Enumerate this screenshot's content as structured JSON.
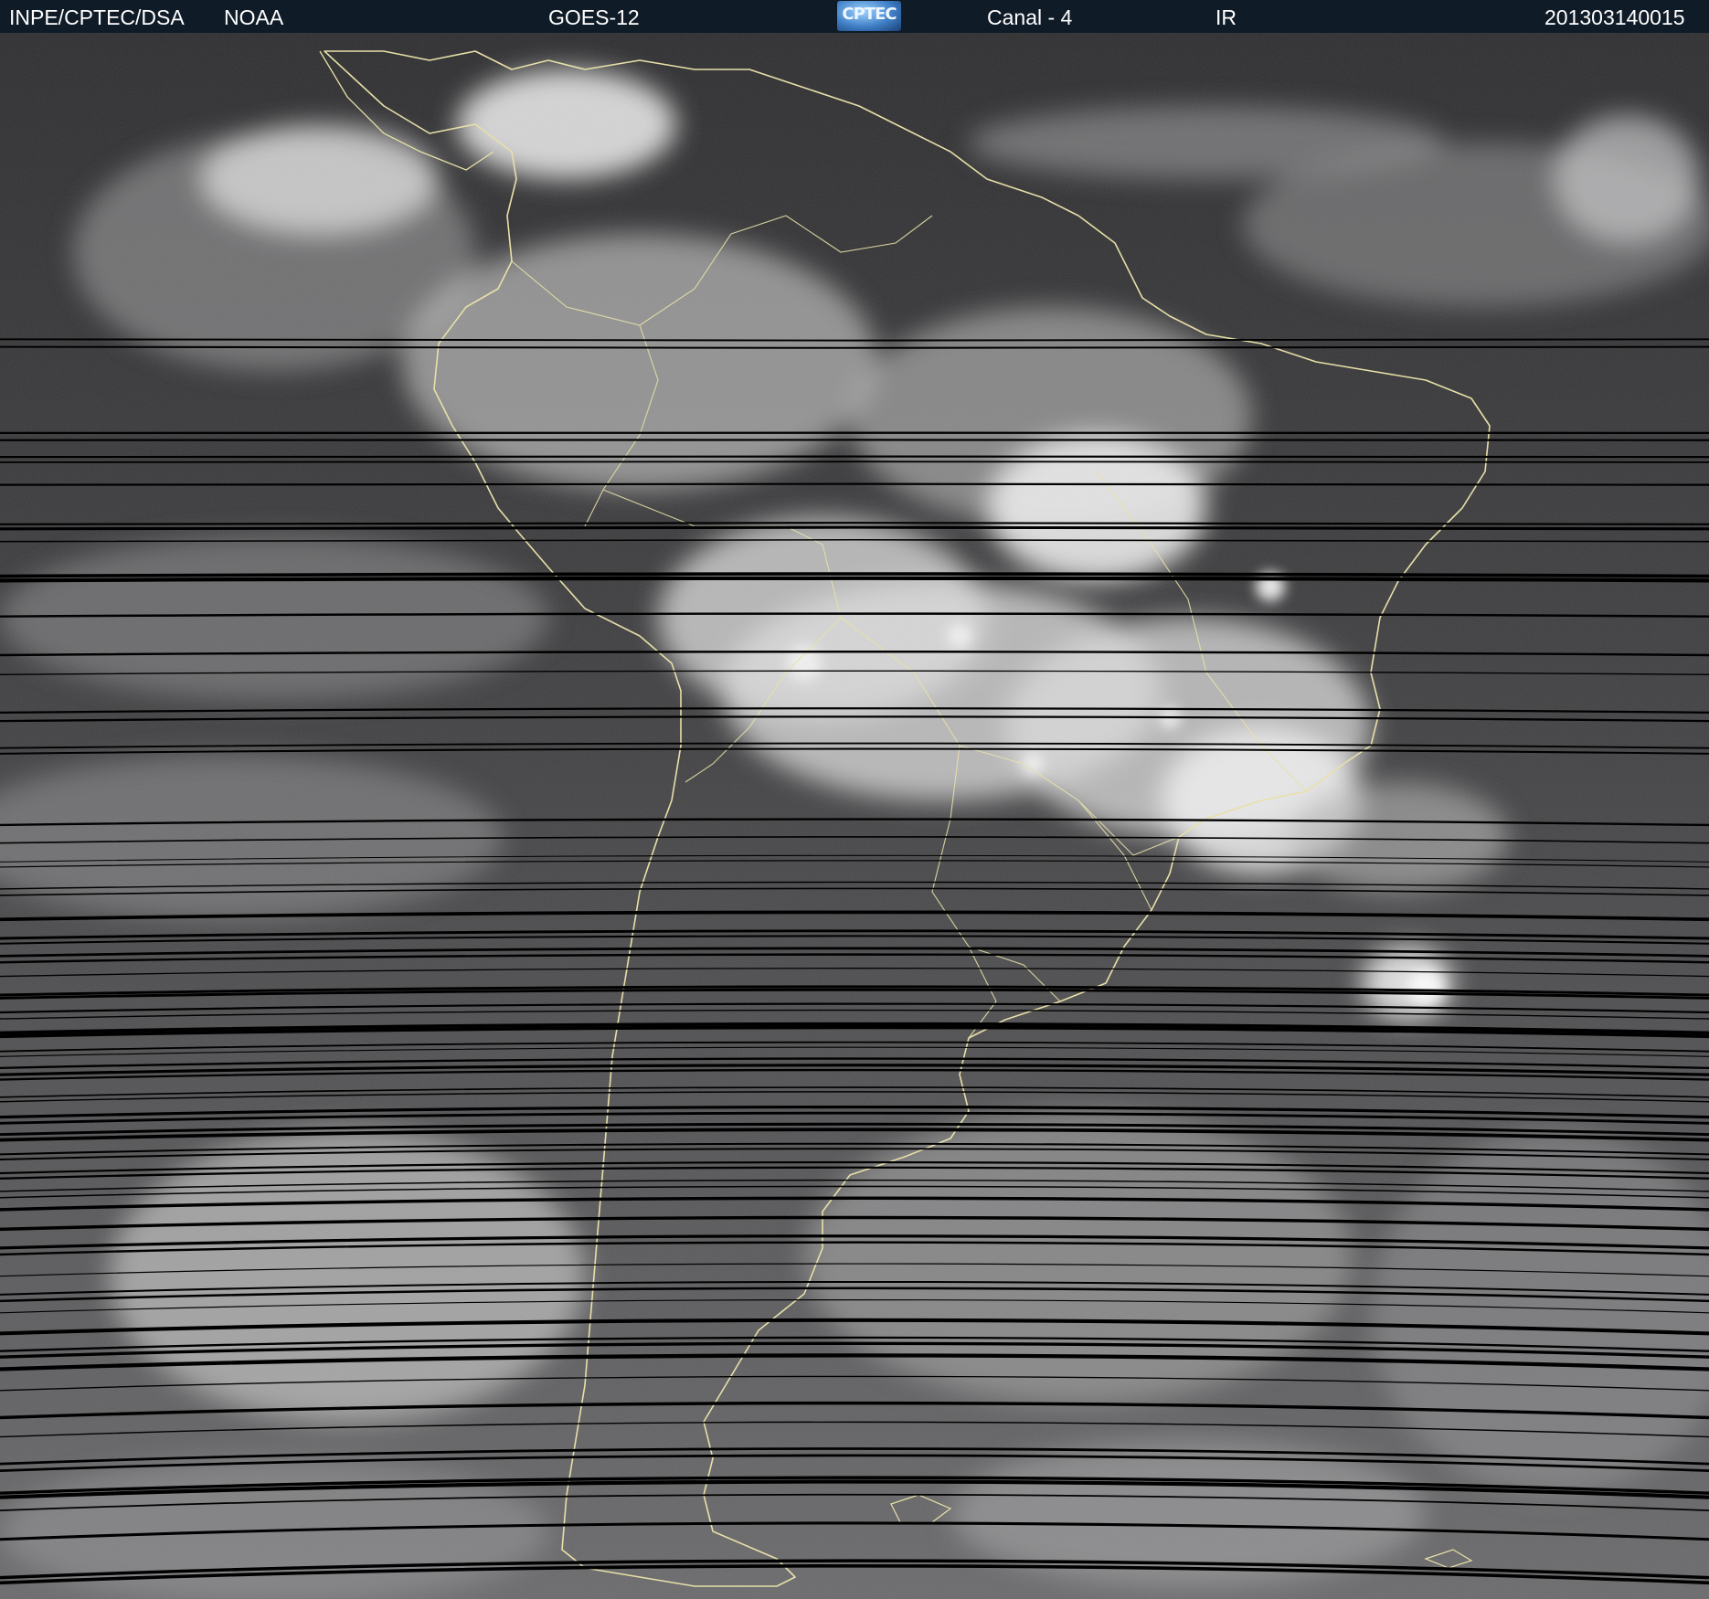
{
  "header": {
    "institution": "INPE/CPTEC/DSA",
    "agency": "NOAA",
    "satellite": "GOES-12",
    "logo_text": "CPTEC",
    "channel": "Canal - 4",
    "band": "IR",
    "timestamp": "201303140015"
  },
  "image": {
    "subject-icon": "goes-12-infrared-satellite-image-south-america",
    "coastline_color": "#e7e0a8",
    "scanline_color": "#000000"
  }
}
